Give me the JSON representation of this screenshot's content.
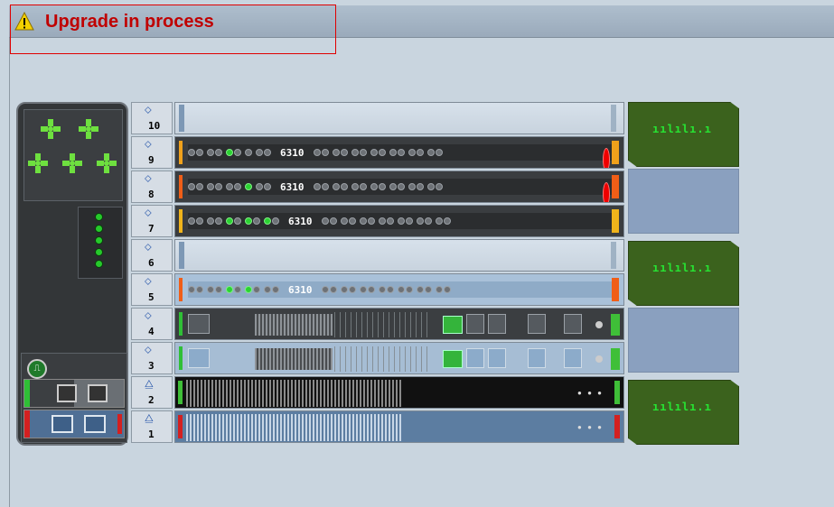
{
  "header": {
    "title": "Upgrade in process"
  },
  "slots": [
    {
      "num": "10",
      "type": "empty"
    },
    {
      "num": "9",
      "type": "switch",
      "model": "6310",
      "variant": "dark",
      "accent": "#f0a11b"
    },
    {
      "num": "8",
      "type": "switch",
      "model": "6310",
      "variant": "dark",
      "accent": "#f05e17"
    },
    {
      "num": "7",
      "type": "switch",
      "model": "6310",
      "variant": "dark",
      "accent": "#f0b41b"
    },
    {
      "num": "6",
      "type": "empty"
    },
    {
      "num": "5",
      "type": "switch",
      "model": "6310",
      "variant": "light",
      "accent": "#f05e17"
    },
    {
      "num": "4",
      "type": "mgmt",
      "variant": "dark"
    },
    {
      "num": "3",
      "type": "mgmt",
      "variant": "light"
    },
    {
      "num": "2",
      "type": "fabric",
      "variant": "dark"
    },
    {
      "num": "1",
      "type": "fabric",
      "variant": "light"
    }
  ],
  "side_panels": [
    {
      "type": "chart",
      "label": "ıılılı.ı"
    },
    {
      "type": "blank"
    },
    {
      "type": "chart",
      "label": "ıılılı.ı"
    },
    {
      "type": "blank"
    },
    {
      "type": "chart",
      "label": "ıılılı.ı"
    }
  ],
  "colors": {
    "alarm": "#c00000",
    "ok_led": "#26c92b",
    "alert_led": "#e00000"
  }
}
